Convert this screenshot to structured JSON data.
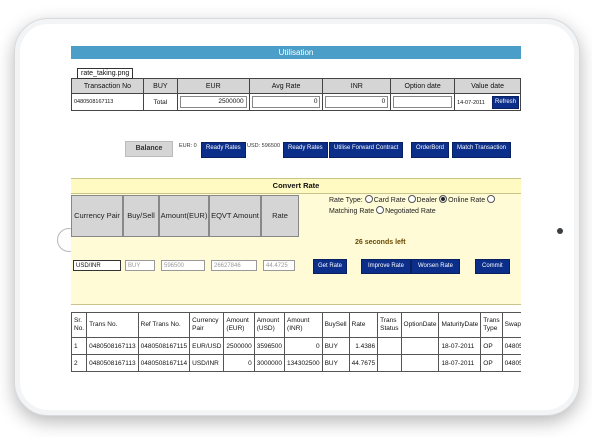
{
  "window_title": "Utilisation",
  "tooltip": "rate_taking.png",
  "top_table": {
    "headers": [
      "Transaction No",
      "BUY",
      "EUR",
      "Avg Rate",
      "INR",
      "Option date",
      "Value date"
    ],
    "row": {
      "transaction_no": "0480508167113",
      "label": "Total",
      "eur": "2500000",
      "avg_rate": "0",
      "inr": "0",
      "value_date": "14-07-2011"
    },
    "refresh_label": "Refresh"
  },
  "balance": {
    "label": "Balance",
    "eur_text": "EUR: 0",
    "usd_text": "USD: 596500",
    "buttons": [
      "Ready Rates",
      "Ready Rates",
      "Utilise Forward Contract",
      "OrderBord",
      "Match Transaction"
    ]
  },
  "convert": {
    "title": "Convert Rate",
    "headers": [
      "Currency Pair",
      "Buy/Sell",
      "Amount(EUR)",
      "EQVT Amount",
      "Rate"
    ],
    "rate_type_label": "Rate Type:",
    "rate_types": [
      "Card Rate",
      "Dealer",
      "Online Rate",
      "Matching Rate",
      "Negotiated Rate"
    ],
    "selected_rate_type": "Online Rate",
    "countdown": "26 seconds left",
    "inputs": {
      "currency_pair": "USD/INR",
      "buy_sell": "BUY",
      "amount": "596500",
      "eqvt_amount": "26627846",
      "rate": "44.4725"
    },
    "buttons": {
      "get_rate": "Get Rate",
      "improve_rate": "Improve Rate",
      "worsen_rate": "Worsen Rate",
      "commit": "Commit"
    }
  },
  "bottom_table": {
    "headers": [
      "Sr. No.",
      "Trans No.",
      "Ref Trans No.",
      "Currency Pair",
      "Amount (EUR)",
      "Amount (USD)",
      "Amount (INR)",
      "BuySell",
      "Rate",
      "Trans Status",
      "OptionDate",
      "MaturityDate",
      "Trans Type",
      "Swap Ref"
    ],
    "rows": [
      [
        "1",
        "0480508167113",
        "0480508167115",
        "EUR/USD",
        "2500000",
        "3596500",
        "0",
        "BUY",
        "1.4386",
        "",
        "",
        "18-07-2011",
        "OP",
        "0480508167116"
      ],
      [
        "2",
        "0480508167113",
        "0480508167114",
        "USD/INR",
        "0",
        "3000000",
        "134302500",
        "BUY",
        "44.7675",
        "",
        "",
        "18-07-2011",
        "OP",
        "0480508167117"
      ]
    ]
  },
  "colors": {
    "title_bar": "#4a9ec7",
    "button": "#0b2e8a",
    "convert_panel": "#fffbd6"
  }
}
